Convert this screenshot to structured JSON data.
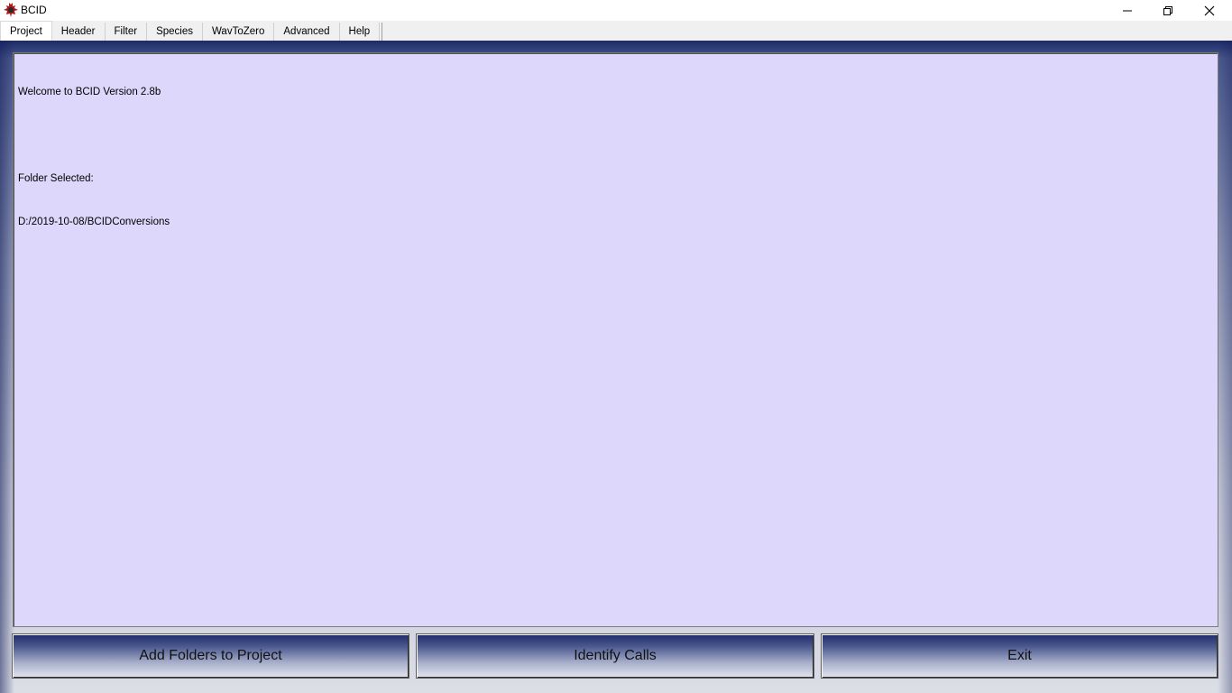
{
  "window": {
    "title": "BCID",
    "icon": "bat-app-icon",
    "controls": {
      "minimize": "minimize-icon",
      "maximize": "restore-icon",
      "close": "close-icon"
    }
  },
  "tabs": [
    {
      "label": "Project",
      "active": true
    },
    {
      "label": "Header",
      "active": false
    },
    {
      "label": "Filter",
      "active": false
    },
    {
      "label": "Species",
      "active": false
    },
    {
      "label": "WavToZero",
      "active": false
    },
    {
      "label": "Advanced",
      "active": false
    },
    {
      "label": "Help",
      "active": false
    }
  ],
  "log": {
    "lines": [
      "Welcome to BCID Version 2.8b",
      "",
      "Folder Selected:",
      "D:/2019-10-08/BCIDConversions"
    ],
    "background": "#dcd7fb"
  },
  "buttons": {
    "add_folders": "Add Folders to Project",
    "identify_calls": "Identify Calls",
    "exit": "Exit"
  },
  "colors": {
    "gradient_top": "#1c2a68",
    "gradient_bottom": "#dcdee6"
  }
}
